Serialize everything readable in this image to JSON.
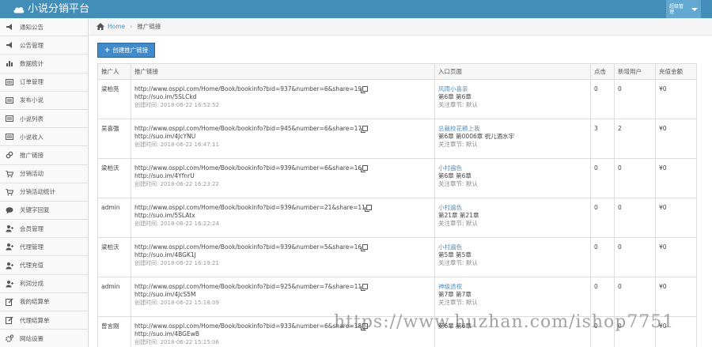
{
  "header": {
    "app_title": "小说分销平台",
    "user_label": "超级管理"
  },
  "sidebar": {
    "items": [
      {
        "label": "通知公告",
        "icon": "megaphone-icon"
      },
      {
        "label": "公告管理",
        "icon": "megaphone-icon"
      },
      {
        "label": "数据统计",
        "icon": "bar-chart-icon"
      },
      {
        "label": "订单管理",
        "icon": "list-icon"
      },
      {
        "label": "发布小说",
        "icon": "list-icon"
      },
      {
        "label": "小说列表",
        "icon": "list-icon"
      },
      {
        "label": "小说收入",
        "icon": "list-icon"
      },
      {
        "label": "推广链接",
        "icon": "link-icon"
      },
      {
        "label": "分销活动",
        "icon": "cart-icon"
      },
      {
        "label": "分销活动统计",
        "icon": "cart-icon"
      },
      {
        "label": "关键字回复",
        "icon": "comment-icon"
      },
      {
        "label": "会员管理",
        "icon": "users-icon"
      },
      {
        "label": "代理管理",
        "icon": "users-icon"
      },
      {
        "label": "代理充值",
        "icon": "users-icon"
      },
      {
        "label": "利润分成",
        "icon": "users-icon"
      },
      {
        "label": "我的结算单",
        "icon": "edit-icon"
      },
      {
        "label": "代理结算单",
        "icon": "edit-icon"
      },
      {
        "label": "网站设置",
        "icon": "gears-icon"
      }
    ]
  },
  "breadcrumb": {
    "home": "Home",
    "current": "推广链接"
  },
  "toolbar": {
    "create_label": "创建推广链接"
  },
  "table": {
    "headers": [
      "推广人",
      "推广链接",
      "入口页面",
      "点击",
      "新增用户",
      "充值金额"
    ],
    "rows": [
      {
        "promoter": "梁柏亮",
        "url": "http://www.osppl.com/Home/Book/bookinfo?bid=937&number=6&share=19",
        "short_url": "http://suo.im/5SLCkd",
        "created": "创建时间: 2018-06-22 16:52:52",
        "book_title": "风雨小喜亲",
        "chapter": "第6章 第6章",
        "note": "关注章节: 默认",
        "clicks": "0",
        "new_users": "0",
        "amount": "¥0"
      },
      {
        "promoter": "吴喜强",
        "url": "http://www.osppl.com/Home/Book/bookinfo?bid=945&number=6&share=17",
        "short_url": "http://suo.im/4JcYNU",
        "created": "创建时间: 2018-06-22 16:47:11",
        "book_title": "总裁校花赖上我",
        "chapter": "第6章 第0006章 祝儿酒水宇",
        "note": "关注章节: 默认",
        "clicks": "3",
        "new_users": "2",
        "amount": "¥0"
      },
      {
        "promoter": "梁柏沃",
        "url": "http://www.osppl.com/Home/Book/bookinfo?bid=939&number=6&share=16",
        "short_url": "http://suo.im/4YfnrU",
        "created": "创建时间: 2018-06-22 16:23:22",
        "book_title": "小村遍色",
        "chapter": "第6章 第6章",
        "note": "关注章节: 默认",
        "clicks": "0",
        "new_users": "0",
        "amount": "¥0"
      },
      {
        "promoter": "admin",
        "url": "http://www.osppl.com/Home/Book/bookinfo?bid=939&number=21&share=11",
        "short_url": "http://suo.im/5SLAtx",
        "created": "创建时间: 2018-06-22 16:22:24",
        "book_title": "小村遍色",
        "chapter": "第21章 第21章",
        "note": "关注章节: 默认",
        "clicks": "0",
        "new_users": "0",
        "amount": "¥0"
      },
      {
        "promoter": "梁柏沃",
        "url": "http://www.osppl.com/Home/Book/bookinfo?bid=939&number=5&share=16",
        "short_url": "http://suo.im/4BGK1J",
        "created": "创建时间: 2018-06-22 16:19:21",
        "book_title": "小村遍色",
        "chapter": "第5章 第5章",
        "note": "关注章节: 默认",
        "clicks": "0",
        "new_users": "0",
        "amount": "¥0"
      },
      {
        "promoter": "admin",
        "url": "http://www.osppl.com/Home/Book/bookinfo?bid=925&number=7&share=11",
        "short_url": "http://suo.im/4JcS5M",
        "created": "创建时间: 2018-06-22 15:18:09",
        "book_title": "神级透视",
        "chapter": "第7章 第7章",
        "note": "关注章节: 默认",
        "clicks": "0",
        "new_users": "0",
        "amount": "¥0"
      },
      {
        "promoter": "曾言刚",
        "url": "http://www.osppl.com/Home/Book/bookinfo?bid=933&number=6&share=18",
        "short_url": "http://suo.im/4BGEwB",
        "created": "创建时间: 2018-06-22 15:15:06",
        "book_title": "",
        "chapter": "第6章 第6章",
        "note": "",
        "clicks": "0",
        "new_users": "0",
        "amount": "¥0"
      }
    ]
  },
  "watermark": "https://www.huzhan.com/ishop7751"
}
